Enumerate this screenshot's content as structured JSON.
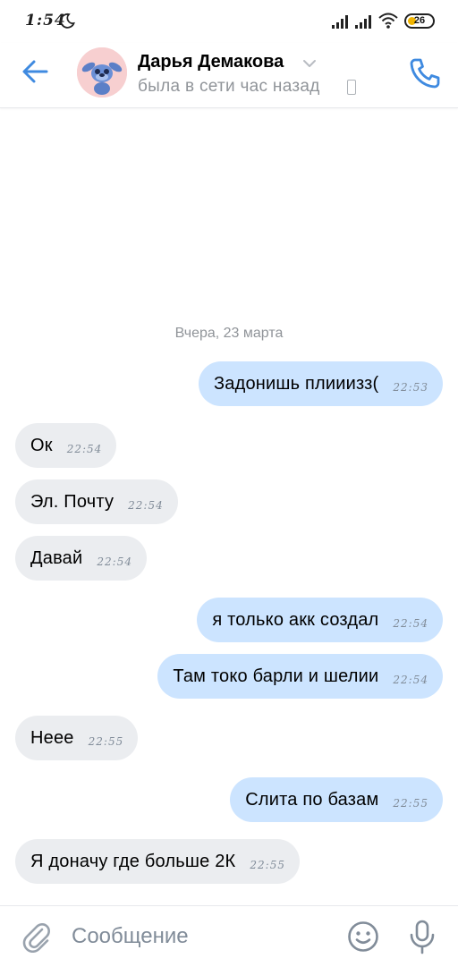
{
  "status_bar": {
    "time": "1:54",
    "battery": "26"
  },
  "header": {
    "contact_name": "Дарья Демакова",
    "contact_status": "была в сети час назад"
  },
  "chat": {
    "date_separator": "Вчера, 23 марта",
    "messages": [
      {
        "direction": "out",
        "text": "Задонишь плииизз(",
        "time": "22:53"
      },
      {
        "direction": "in",
        "text": "Ок",
        "time": "22:54"
      },
      {
        "direction": "in",
        "text": "Эл. Почту",
        "time": "22:54"
      },
      {
        "direction": "in",
        "text": "Давай",
        "time": "22:54"
      },
      {
        "direction": "out",
        "text": "я только акк создал",
        "time": "22:54"
      },
      {
        "direction": "out",
        "text": "Там токо барли и шелии",
        "time": "22:54"
      },
      {
        "direction": "in",
        "text": "Неее",
        "time": "22:55"
      },
      {
        "direction": "out",
        "text": "Слита по базам",
        "time": "22:55"
      },
      {
        "direction": "in",
        "text": "Я доначу где больше 2К",
        "time": "22:55"
      }
    ]
  },
  "composer": {
    "placeholder": "Сообщение"
  },
  "colors": {
    "accent": "#3f8ae0",
    "outgoing_bubble": "#cce4ff",
    "incoming_bubble": "#ebedf0",
    "secondary_text": "#909499",
    "battery": "#f0b400"
  },
  "icons": {
    "status_bar": [
      "moon-icon",
      "signal-icon",
      "signal-icon",
      "wifi-icon",
      "battery-icon"
    ],
    "header": [
      "back-arrow-icon",
      "avatar",
      "chevron-down-icon",
      "phone-device-icon",
      "phone-call-icon"
    ],
    "composer": [
      "paperclip-icon",
      "smile-icon",
      "microphone-icon"
    ]
  }
}
